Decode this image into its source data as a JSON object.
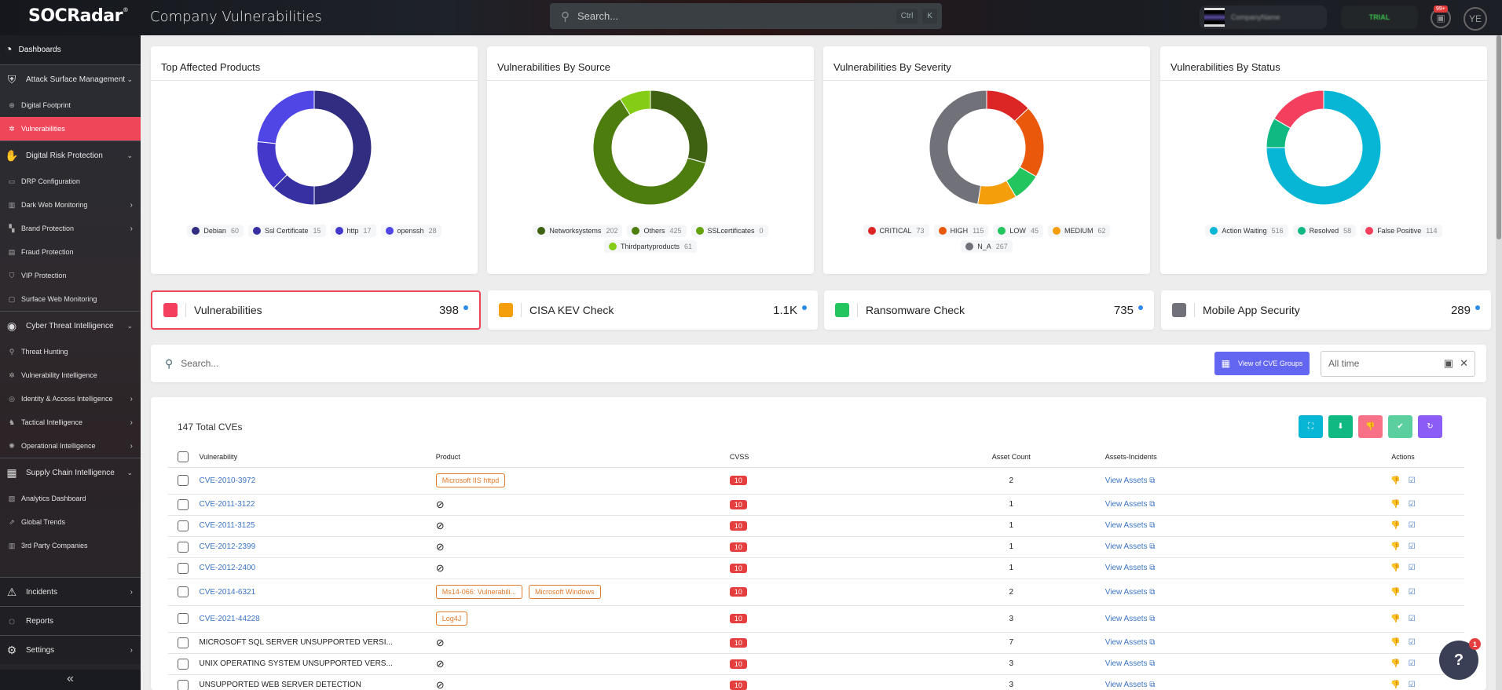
{
  "header": {
    "logo": "SOCRadar",
    "page_title": "Company Vulnerabilities",
    "search_placeholder": "Search...",
    "shortcut_ctrl": "Ctrl",
    "shortcut_k": "K",
    "org_name": "CompanyName",
    "trial_label": "TRIAL",
    "notification_badge": "99+",
    "user_initials": "YE"
  },
  "sidebar": {
    "dashboards": "Dashboards",
    "sections": [
      {
        "label": "Attack Surface Management",
        "icon": "shield-icon",
        "items": [
          {
            "label": "Digital Footprint",
            "icon": "globe-icon"
          },
          {
            "label": "Vulnerabilities",
            "icon": "bug-icon",
            "active": true
          }
        ]
      },
      {
        "label": "Digital Risk Protection",
        "icon": "hand-icon",
        "items": [
          {
            "label": "DRP Configuration",
            "icon": "laptop-icon"
          },
          {
            "label": "Dark Web Monitoring",
            "icon": "building-icon",
            "chevron": true
          },
          {
            "label": "Brand Protection",
            "icon": "brand-icon",
            "chevron": true
          },
          {
            "label": "Fraud Protection",
            "icon": "fraud-icon"
          },
          {
            "label": "VIP Protection",
            "icon": "vip-shield-icon"
          },
          {
            "label": "Surface Web Monitoring",
            "icon": "web-icon"
          }
        ]
      },
      {
        "label": "Cyber Threat Intelligence",
        "icon": "eye-shield-icon",
        "items": [
          {
            "label": "Threat Hunting",
            "icon": "search-icon"
          },
          {
            "label": "Vulnerability Intelligence",
            "icon": "bug-icon"
          },
          {
            "label": "Identity & Access Intelligence",
            "icon": "fingerprint-icon",
            "chevron": true
          },
          {
            "label": "Tactical Intelligence",
            "icon": "chess-knight-icon",
            "chevron": true
          },
          {
            "label": "Operational Intelligence",
            "icon": "virus-icon",
            "chevron": true
          }
        ]
      },
      {
        "label": "Supply Chain Intelligence",
        "icon": "network-icon",
        "items": [
          {
            "label": "Analytics Dashboard",
            "icon": "analytics-icon"
          },
          {
            "label": "Global Trends",
            "icon": "trend-icon"
          },
          {
            "label": "3rd Party Companies",
            "icon": "companies-icon"
          }
        ]
      }
    ],
    "bottom": [
      {
        "label": "Incidents",
        "icon": "alert-icon",
        "chevron": true
      },
      {
        "label": "Reports",
        "icon": "report-icon"
      },
      {
        "label": "Settings",
        "icon": "gear-icon",
        "chevron": true
      }
    ],
    "collapse_icon": "«"
  },
  "chart_data": [
    {
      "type": "pie",
      "title": "Top Affected Products",
      "donut": true,
      "labels": [
        "Debian",
        "Ssl Certificate",
        "http",
        "openssh"
      ],
      "values": [
        60,
        15,
        17,
        28
      ],
      "colors": [
        "#312e81",
        "#3730a3",
        "#4338ca",
        "#4f46e5"
      ],
      "legend": "bottom"
    },
    {
      "type": "pie",
      "title": "Vulnerabilities By Source",
      "donut": true,
      "labels": [
        "Networksystems",
        "Others",
        "SSLcertificates",
        "Thirdpartyproducts"
      ],
      "values": [
        202,
        425,
        0,
        61
      ],
      "colors": [
        "#3f6212",
        "#4d7c0f",
        "#65a30d",
        "#84cc16"
      ],
      "legend": "bottom"
    },
    {
      "type": "pie",
      "title": "Vulnerabilities By Severity",
      "donut": true,
      "labels": [
        "CRITICAL",
        "HIGH",
        "LOW",
        "MEDIUM",
        "N_A"
      ],
      "values": [
        73,
        115,
        45,
        62,
        267
      ],
      "colors": [
        "#dc2626",
        "#ea580c",
        "#22c55e",
        "#f59e0b",
        "#71717a"
      ],
      "legend": "bottom"
    },
    {
      "type": "pie",
      "title": "Vulnerabilities By Status",
      "donut": true,
      "labels": [
        "Action Waiting",
        "Resolved",
        "False Positive"
      ],
      "values": [
        516,
        58,
        114
      ],
      "colors": [
        "#06b6d4",
        "#10b981",
        "#f43f5e"
      ],
      "legend": "bottom"
    }
  ],
  "stats": [
    {
      "label": "Vulnerabilities",
      "value": "398",
      "color": "#f43f5e",
      "selected": true
    },
    {
      "label": "CISA KEV Check",
      "value": "1.1K",
      "color": "#f59e0b"
    },
    {
      "label": "Ransomware Check",
      "value": "735",
      "color": "#22c55e"
    },
    {
      "label": "Mobile App Security",
      "value": "289",
      "color": "#71717a"
    }
  ],
  "filter": {
    "search_placeholder": "Search...",
    "cve_groups_label": "View of CVE Groups",
    "date_value": "All time"
  },
  "table": {
    "total_label": "147 Total CVEs",
    "action_buttons": [
      {
        "name": "scan-button",
        "icon": "scan-icon",
        "color": "#06b6d4",
        "glyph": "⛶"
      },
      {
        "name": "download-button",
        "icon": "download-icon",
        "color": "#10b981",
        "glyph": "⬇"
      },
      {
        "name": "false-positive-button",
        "icon": "thumbs-down-icon",
        "color": "#f87186",
        "glyph": "👎"
      },
      {
        "name": "resolve-button",
        "icon": "check-icon",
        "color": "#5ccf9f",
        "glyph": "✔"
      },
      {
        "name": "refresh-button",
        "icon": "refresh-icon",
        "color": "#8b5cf6",
        "glyph": "↻"
      }
    ],
    "columns": [
      "Vulnerability",
      "Product",
      "CVSS",
      "Asset Count",
      "Assets-Incidents",
      "Actions"
    ],
    "rows": [
      {
        "vuln": "CVE-2010-3972",
        "link": true,
        "products": [
          "Microsoft IIS httpd"
        ],
        "cvss": "10",
        "assets": "2",
        "view": "View Assets"
      },
      {
        "vuln": "CVE-2011-3122",
        "link": true,
        "products": [],
        "cvss": "10",
        "assets": "1",
        "view": "View Assets"
      },
      {
        "vuln": "CVE-2011-3125",
        "link": true,
        "products": [],
        "cvss": "10",
        "assets": "1",
        "view": "View Assets"
      },
      {
        "vuln": "CVE-2012-2399",
        "link": true,
        "products": [],
        "cvss": "10",
        "assets": "1",
        "view": "View Assets"
      },
      {
        "vuln": "CVE-2012-2400",
        "link": true,
        "products": [],
        "cvss": "10",
        "assets": "1",
        "view": "View Assets"
      },
      {
        "vuln": "CVE-2014-6321",
        "link": true,
        "products": [
          "Ms14-066: Vulnerabili...",
          "Microsoft Windows"
        ],
        "cvss": "10",
        "assets": "2",
        "view": "View Assets"
      },
      {
        "vuln": "CVE-2021-44228",
        "link": true,
        "products": [
          "Log4J"
        ],
        "cvss": "10",
        "assets": "3",
        "view": "View Assets"
      },
      {
        "vuln": "MICROSOFT SQL SERVER UNSUPPORTED VERSI...",
        "link": false,
        "products": [],
        "cvss": "10",
        "assets": "7",
        "view": "View Assets"
      },
      {
        "vuln": "UNIX OPERATING SYSTEM UNSUPPORTED VERS...",
        "link": false,
        "products": [],
        "cvss": "10",
        "assets": "3",
        "view": "View Assets"
      },
      {
        "vuln": "UNSUPPORTED WEB SERVER DETECTION",
        "link": false,
        "products": [],
        "cvss": "10",
        "assets": "3",
        "view": "View Assets"
      }
    ]
  },
  "help": {
    "badge": "1"
  }
}
